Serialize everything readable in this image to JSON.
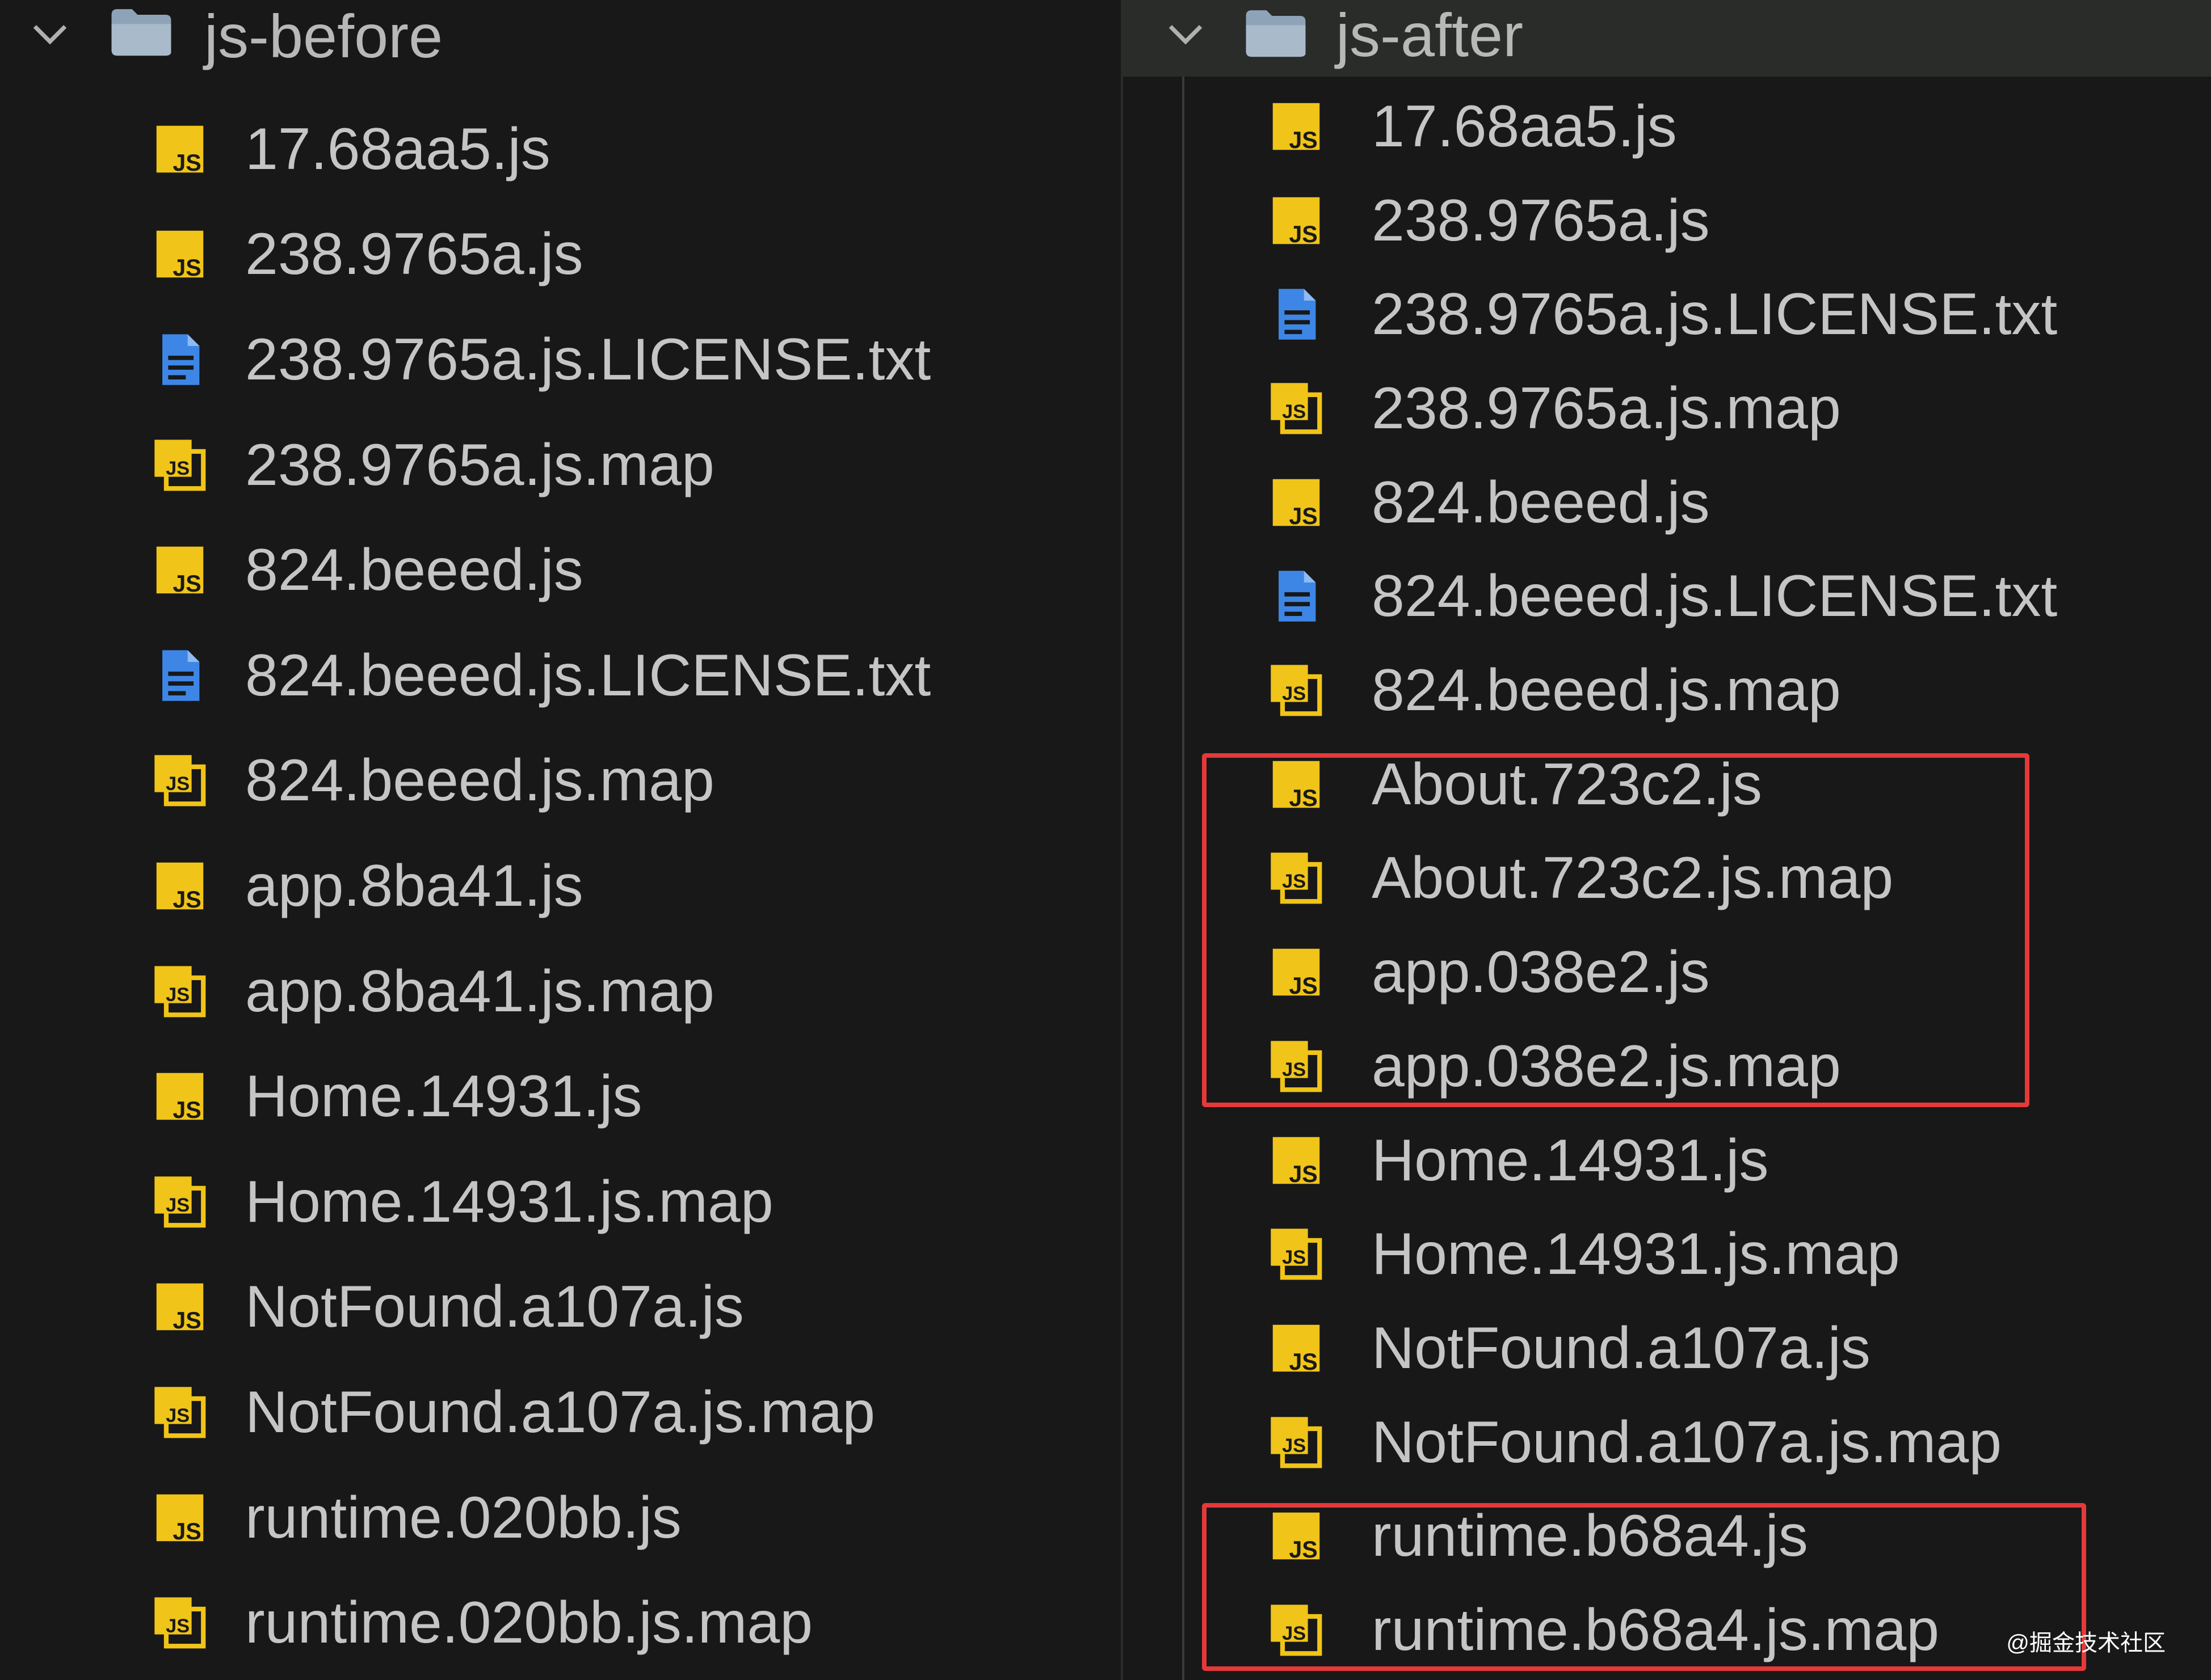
{
  "left_pane": {
    "folder_name": "js-before",
    "files": [
      {
        "name": "17.68aa5.js",
        "icon": "js-file-icon"
      },
      {
        "name": "238.9765a.js",
        "icon": "js-file-icon"
      },
      {
        "name": "238.9765a.js.LICENSE.txt",
        "icon": "text-file-icon"
      },
      {
        "name": "238.9765a.js.map",
        "icon": "js-map-file-icon"
      },
      {
        "name": "824.beeed.js",
        "icon": "js-file-icon"
      },
      {
        "name": "824.beeed.js.LICENSE.txt",
        "icon": "text-file-icon"
      },
      {
        "name": "824.beeed.js.map",
        "icon": "js-map-file-icon"
      },
      {
        "name": "app.8ba41.js",
        "icon": "js-file-icon"
      },
      {
        "name": "app.8ba41.js.map",
        "icon": "js-map-file-icon"
      },
      {
        "name": "Home.14931.js",
        "icon": "js-file-icon"
      },
      {
        "name": "Home.14931.js.map",
        "icon": "js-map-file-icon"
      },
      {
        "name": "NotFound.a107a.js",
        "icon": "js-file-icon"
      },
      {
        "name": "NotFound.a107a.js.map",
        "icon": "js-map-file-icon"
      },
      {
        "name": "runtime.020bb.js",
        "icon": "js-file-icon"
      },
      {
        "name": "runtime.020bb.js.map",
        "icon": "js-map-file-icon"
      }
    ]
  },
  "right_pane": {
    "folder_name": "js-after",
    "files": [
      {
        "name": "17.68aa5.js",
        "icon": "js-file-icon"
      },
      {
        "name": "238.9765a.js",
        "icon": "js-file-icon"
      },
      {
        "name": "238.9765a.js.LICENSE.txt",
        "icon": "text-file-icon"
      },
      {
        "name": "238.9765a.js.map",
        "icon": "js-map-file-icon"
      },
      {
        "name": "824.beeed.js",
        "icon": "js-file-icon"
      },
      {
        "name": "824.beeed.js.LICENSE.txt",
        "icon": "text-file-icon"
      },
      {
        "name": "824.beeed.js.map",
        "icon": "js-map-file-icon"
      },
      {
        "name": "About.723c2.js",
        "icon": "js-file-icon"
      },
      {
        "name": "About.723c2.js.map",
        "icon": "js-map-file-icon"
      },
      {
        "name": "app.038e2.js",
        "icon": "js-file-icon"
      },
      {
        "name": "app.038e2.js.map",
        "icon": "js-map-file-icon"
      },
      {
        "name": "Home.14931.js",
        "icon": "js-file-icon"
      },
      {
        "name": "Home.14931.js.map",
        "icon": "js-map-file-icon"
      },
      {
        "name": "NotFound.a107a.js",
        "icon": "js-file-icon"
      },
      {
        "name": "NotFound.a107a.js.map",
        "icon": "js-map-file-icon"
      },
      {
        "name": "runtime.b68a4.js",
        "icon": "js-file-icon"
      },
      {
        "name": "runtime.b68a4.js.map",
        "icon": "js-map-file-icon"
      }
    ]
  },
  "highlight_color": "#e5393a",
  "js_icon_color": "#f0c419",
  "text_icon_color": "#3e86e6",
  "watermark": "@掘金技术社区"
}
